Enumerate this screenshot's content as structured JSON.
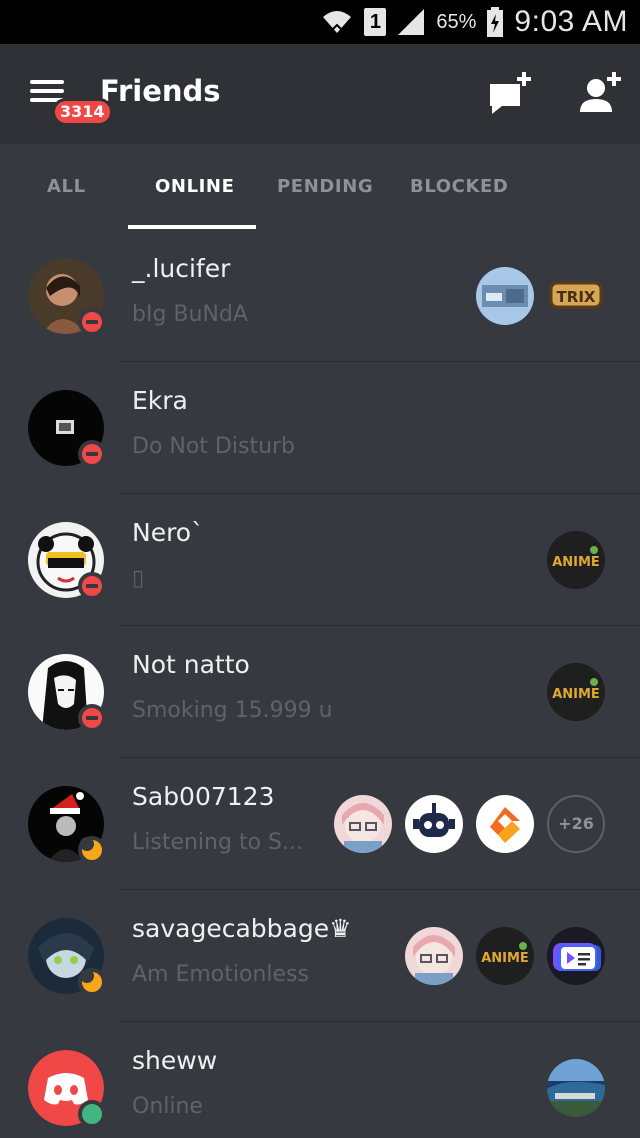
{
  "status_bar": {
    "sim_slot": "1",
    "battery_percent": "65%",
    "time": "9:03 AM"
  },
  "appbar": {
    "title": "Friends",
    "notification_count": "3314"
  },
  "tabs": [
    {
      "label": "ALL",
      "active": false
    },
    {
      "label": "ONLINE",
      "active": true
    },
    {
      "label": "PENDING",
      "active": false
    },
    {
      "label": "BLOCKED",
      "active": false
    }
  ],
  "friends": [
    {
      "name": "_.lucifer",
      "status_text": "bIg BuNdA",
      "presence": "dnd",
      "mutual_guilds": [
        "photo-guild-icon",
        "trix-guild-icon"
      ]
    },
    {
      "name": "Ekra",
      "status_text": "Do Not Disturb",
      "presence": "dnd",
      "mutual_guilds": []
    },
    {
      "name": "Nero`",
      "status_text": "▯",
      "presence": "dnd",
      "mutual_guilds": [
        "anime-guild-icon"
      ]
    },
    {
      "name": "Not natto",
      "status_text": "Smoking 15.999 u",
      "presence": "dnd",
      "mutual_guilds": [
        "anime-guild-icon"
      ]
    },
    {
      "name": "Sab007123",
      "status_text": "Listening to S...",
      "presence": "idle",
      "mutual_guilds": [
        "anime-girl-guild-icon",
        "robot-guild-icon",
        "orange-logo-guild-icon"
      ],
      "more_guilds": "+26"
    },
    {
      "name": "savagecabbage♛",
      "status_text": "Am Emotionless",
      "presence": "idle",
      "mutual_guilds": [
        "anime-girl-guild-icon",
        "anime-guild-icon",
        "media-guild-icon"
      ]
    },
    {
      "name": "sheww",
      "status_text": "Online",
      "presence": "online",
      "mutual_guilds": [
        "landscape-guild-icon"
      ]
    }
  ],
  "colors": {
    "background": "#36393f",
    "appbar": "#2f3136",
    "dnd": "#f04747",
    "idle": "#faa61a",
    "online": "#43b581",
    "discord_blurple": "#f04747"
  }
}
